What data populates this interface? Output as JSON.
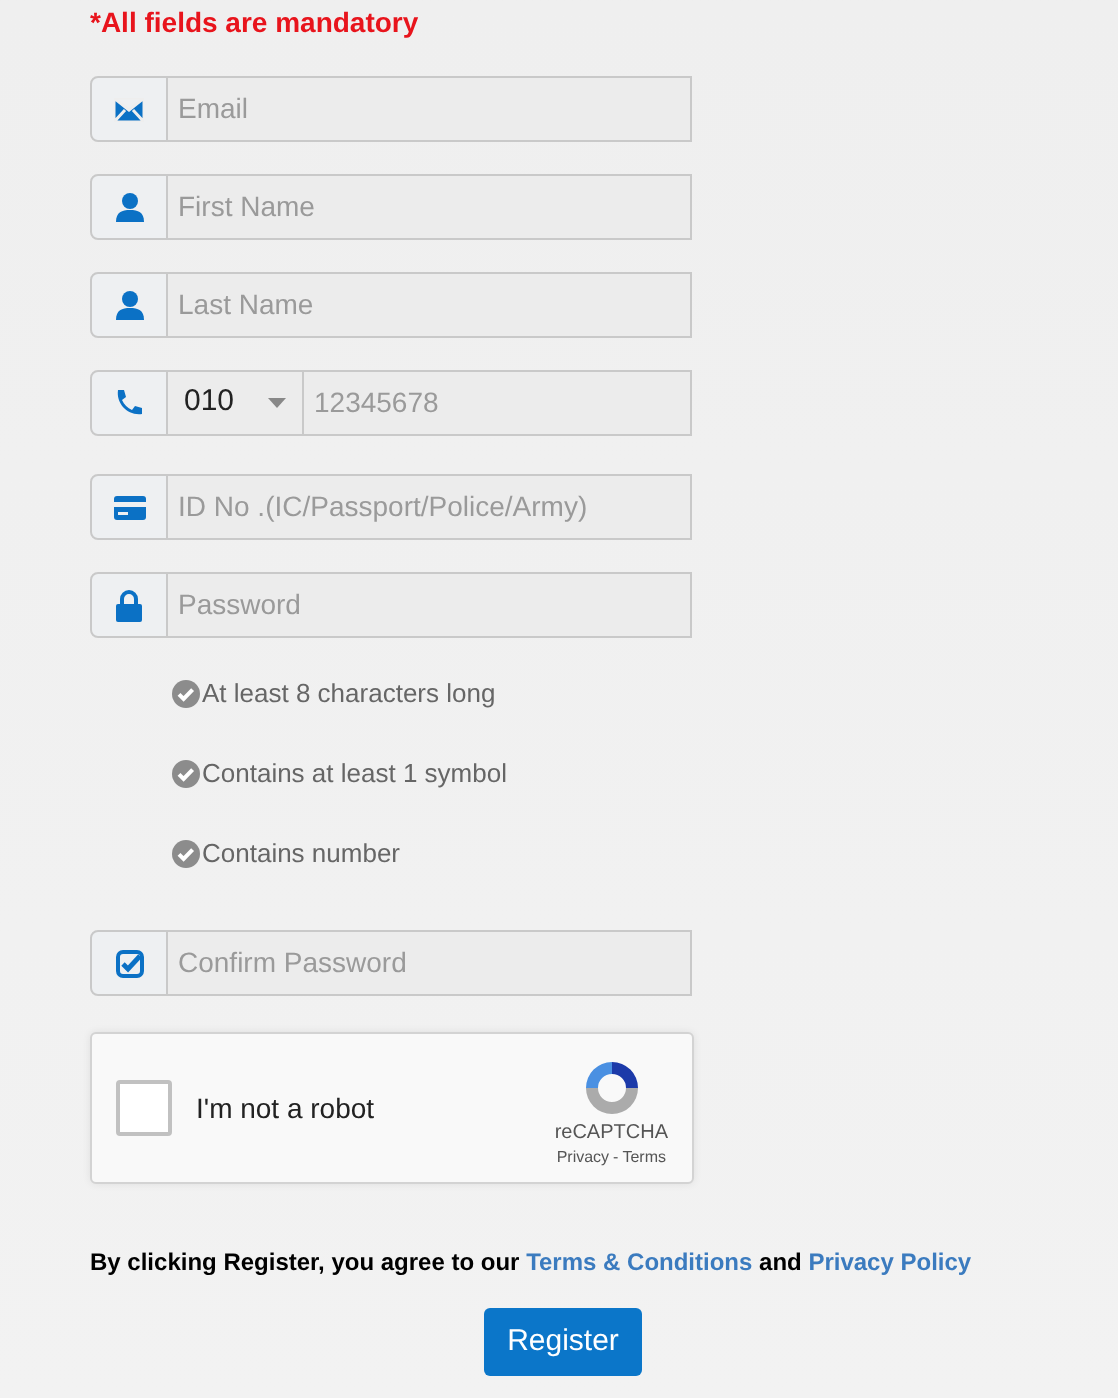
{
  "notice": {
    "mark": "*",
    "text": "All fields are mandatory"
  },
  "fields": [
    {
      "kind": "email",
      "placeholder": "Email"
    },
    {
      "kind": "person",
      "placeholder": "First Name"
    },
    {
      "kind": "person",
      "placeholder": "Last Name"
    },
    {
      "kind": "phone",
      "prefix": "010",
      "placeholder": "12345678"
    },
    {
      "kind": "card",
      "placeholder": "ID No .(IC/Passport/Police/Army)"
    },
    {
      "kind": "lock",
      "placeholder": "Password"
    },
    {
      "kind": "rules",
      "items": [
        "At least 8 characters long",
        "Contains at least 1 symbol",
        "Contains number"
      ]
    },
    {
      "kind": "confirm",
      "placeholder": "Confirm Password"
    }
  ],
  "captcha": {
    "label": "I'm not a robot",
    "checked": false,
    "brand": "reCAPTCHA",
    "links": [
      "Privacy",
      "Terms"
    ],
    "separator": "-"
  },
  "agreement": {
    "text": "By clicking Register, you agree to our",
    "link_1": "Terms & Conditions",
    "joiner": "and",
    "link_2": "Privacy Policy"
  },
  "submit": "Register"
}
